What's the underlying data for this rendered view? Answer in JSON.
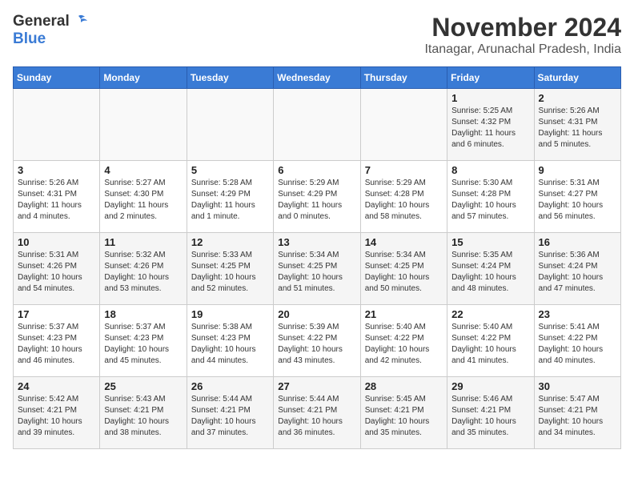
{
  "header": {
    "logo_general": "General",
    "logo_blue": "Blue",
    "month_year": "November 2024",
    "location": "Itanagar, Arunachal Pradesh, India"
  },
  "calendar": {
    "days_of_week": [
      "Sunday",
      "Monday",
      "Tuesday",
      "Wednesday",
      "Thursday",
      "Friday",
      "Saturday"
    ],
    "weeks": [
      [
        {
          "day": "",
          "sunrise": "",
          "sunset": "",
          "daylight": ""
        },
        {
          "day": "",
          "sunrise": "",
          "sunset": "",
          "daylight": ""
        },
        {
          "day": "",
          "sunrise": "",
          "sunset": "",
          "daylight": ""
        },
        {
          "day": "",
          "sunrise": "",
          "sunset": "",
          "daylight": ""
        },
        {
          "day": "",
          "sunrise": "",
          "sunset": "",
          "daylight": ""
        },
        {
          "day": "1",
          "sunrise": "Sunrise: 5:25 AM",
          "sunset": "Sunset: 4:32 PM",
          "daylight": "Daylight: 11 hours and 6 minutes."
        },
        {
          "day": "2",
          "sunrise": "Sunrise: 5:26 AM",
          "sunset": "Sunset: 4:31 PM",
          "daylight": "Daylight: 11 hours and 5 minutes."
        }
      ],
      [
        {
          "day": "3",
          "sunrise": "Sunrise: 5:26 AM",
          "sunset": "Sunset: 4:31 PM",
          "daylight": "Daylight: 11 hours and 4 minutes."
        },
        {
          "day": "4",
          "sunrise": "Sunrise: 5:27 AM",
          "sunset": "Sunset: 4:30 PM",
          "daylight": "Daylight: 11 hours and 2 minutes."
        },
        {
          "day": "5",
          "sunrise": "Sunrise: 5:28 AM",
          "sunset": "Sunset: 4:29 PM",
          "daylight": "Daylight: 11 hours and 1 minute."
        },
        {
          "day": "6",
          "sunrise": "Sunrise: 5:29 AM",
          "sunset": "Sunset: 4:29 PM",
          "daylight": "Daylight: 11 hours and 0 minutes."
        },
        {
          "day": "7",
          "sunrise": "Sunrise: 5:29 AM",
          "sunset": "Sunset: 4:28 PM",
          "daylight": "Daylight: 10 hours and 58 minutes."
        },
        {
          "day": "8",
          "sunrise": "Sunrise: 5:30 AM",
          "sunset": "Sunset: 4:28 PM",
          "daylight": "Daylight: 10 hours and 57 minutes."
        },
        {
          "day": "9",
          "sunrise": "Sunrise: 5:31 AM",
          "sunset": "Sunset: 4:27 PM",
          "daylight": "Daylight: 10 hours and 56 minutes."
        }
      ],
      [
        {
          "day": "10",
          "sunrise": "Sunrise: 5:31 AM",
          "sunset": "Sunset: 4:26 PM",
          "daylight": "Daylight: 10 hours and 54 minutes."
        },
        {
          "day": "11",
          "sunrise": "Sunrise: 5:32 AM",
          "sunset": "Sunset: 4:26 PM",
          "daylight": "Daylight: 10 hours and 53 minutes."
        },
        {
          "day": "12",
          "sunrise": "Sunrise: 5:33 AM",
          "sunset": "Sunset: 4:25 PM",
          "daylight": "Daylight: 10 hours and 52 minutes."
        },
        {
          "day": "13",
          "sunrise": "Sunrise: 5:34 AM",
          "sunset": "Sunset: 4:25 PM",
          "daylight": "Daylight: 10 hours and 51 minutes."
        },
        {
          "day": "14",
          "sunrise": "Sunrise: 5:34 AM",
          "sunset": "Sunset: 4:25 PM",
          "daylight": "Daylight: 10 hours and 50 minutes."
        },
        {
          "day": "15",
          "sunrise": "Sunrise: 5:35 AM",
          "sunset": "Sunset: 4:24 PM",
          "daylight": "Daylight: 10 hours and 48 minutes."
        },
        {
          "day": "16",
          "sunrise": "Sunrise: 5:36 AM",
          "sunset": "Sunset: 4:24 PM",
          "daylight": "Daylight: 10 hours and 47 minutes."
        }
      ],
      [
        {
          "day": "17",
          "sunrise": "Sunrise: 5:37 AM",
          "sunset": "Sunset: 4:23 PM",
          "daylight": "Daylight: 10 hours and 46 minutes."
        },
        {
          "day": "18",
          "sunrise": "Sunrise: 5:37 AM",
          "sunset": "Sunset: 4:23 PM",
          "daylight": "Daylight: 10 hours and 45 minutes."
        },
        {
          "day": "19",
          "sunrise": "Sunrise: 5:38 AM",
          "sunset": "Sunset: 4:23 PM",
          "daylight": "Daylight: 10 hours and 44 minutes."
        },
        {
          "day": "20",
          "sunrise": "Sunrise: 5:39 AM",
          "sunset": "Sunset: 4:22 PM",
          "daylight": "Daylight: 10 hours and 43 minutes."
        },
        {
          "day": "21",
          "sunrise": "Sunrise: 5:40 AM",
          "sunset": "Sunset: 4:22 PM",
          "daylight": "Daylight: 10 hours and 42 minutes."
        },
        {
          "day": "22",
          "sunrise": "Sunrise: 5:40 AM",
          "sunset": "Sunset: 4:22 PM",
          "daylight": "Daylight: 10 hours and 41 minutes."
        },
        {
          "day": "23",
          "sunrise": "Sunrise: 5:41 AM",
          "sunset": "Sunset: 4:22 PM",
          "daylight": "Daylight: 10 hours and 40 minutes."
        }
      ],
      [
        {
          "day": "24",
          "sunrise": "Sunrise: 5:42 AM",
          "sunset": "Sunset: 4:21 PM",
          "daylight": "Daylight: 10 hours and 39 minutes."
        },
        {
          "day": "25",
          "sunrise": "Sunrise: 5:43 AM",
          "sunset": "Sunset: 4:21 PM",
          "daylight": "Daylight: 10 hours and 38 minutes."
        },
        {
          "day": "26",
          "sunrise": "Sunrise: 5:44 AM",
          "sunset": "Sunset: 4:21 PM",
          "daylight": "Daylight: 10 hours and 37 minutes."
        },
        {
          "day": "27",
          "sunrise": "Sunrise: 5:44 AM",
          "sunset": "Sunset: 4:21 PM",
          "daylight": "Daylight: 10 hours and 36 minutes."
        },
        {
          "day": "28",
          "sunrise": "Sunrise: 5:45 AM",
          "sunset": "Sunset: 4:21 PM",
          "daylight": "Daylight: 10 hours and 35 minutes."
        },
        {
          "day": "29",
          "sunrise": "Sunrise: 5:46 AM",
          "sunset": "Sunset: 4:21 PM",
          "daylight": "Daylight: 10 hours and 35 minutes."
        },
        {
          "day": "30",
          "sunrise": "Sunrise: 5:47 AM",
          "sunset": "Sunset: 4:21 PM",
          "daylight": "Daylight: 10 hours and 34 minutes."
        }
      ]
    ]
  }
}
